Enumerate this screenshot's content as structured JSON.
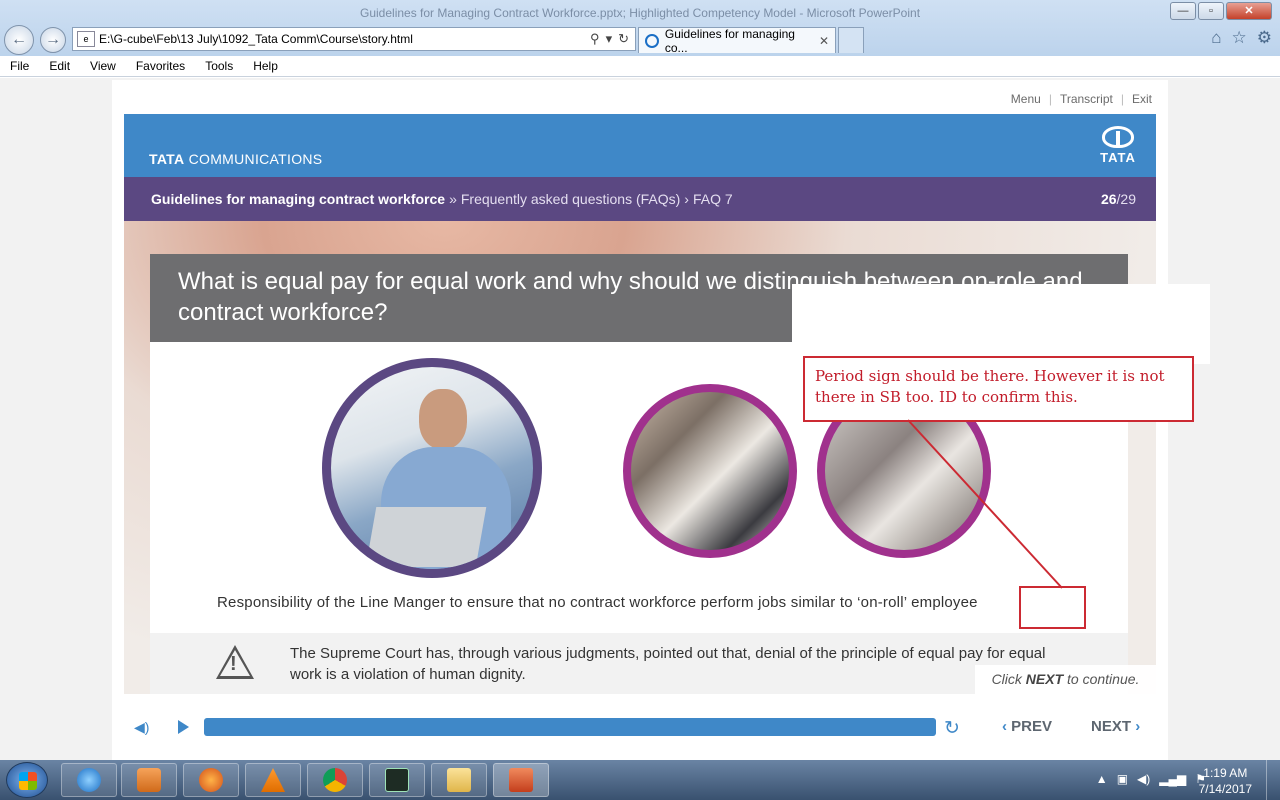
{
  "window": {
    "title": "Guidelines for Managing Contract Workforce.pptx; Highlighted Competency Model - Microsoft PowerPoint",
    "controls": {
      "minimize": "—",
      "maximize": "▫",
      "close": "✕"
    }
  },
  "browser": {
    "address": "E:\\G-cube\\Feb\\13 July\\1092_Tata Comm\\Course\\story.html",
    "tab_title": "Guidelines for managing co...",
    "menu": [
      "File",
      "Edit",
      "View",
      "Favorites",
      "Tools",
      "Help"
    ]
  },
  "player": {
    "top_links": {
      "menu": "Menu",
      "transcript": "Transcript",
      "exit": "Exit",
      "separator": "|"
    },
    "controls": {
      "prev": "PREV",
      "next": "NEXT",
      "progress_fraction": 1.0
    }
  },
  "slide": {
    "brand": {
      "bold": "TATA",
      "rest": " COMMUNICATIONS",
      "logo_word": "TATA"
    },
    "breadcrumb": {
      "course": "Guidelines for managing contract workforce",
      "sep1": "»",
      "section": "Frequently asked questions (FAQs)",
      "sep2": "›",
      "page": "FAQ 7",
      "current": "26",
      "total": "/29"
    },
    "question": "What is equal pay for equal work and why should we distinguish between on-role and contract workforce?",
    "caption": "Responsibility of the Line Manger to ensure that no contract workforce perform jobs similar to ‘on-roll’ employee",
    "notice": "The Supreme Court has, through various judgments, pointed out that, denial of the principle of equal pay for equal work is a violation of human dignity.",
    "hint": {
      "pre": "Click ",
      "bold": "NEXT",
      "post": " to continue."
    }
  },
  "annotation": {
    "text": "Period sign should be there. However it is not there in SB too. ID to confirm this.",
    "color": "#cc2a33"
  },
  "taskbar": {
    "time": "1:19 AM",
    "date": "7/14/2017"
  },
  "colors": {
    "brand_blue": "#3f88c8",
    "crumb_purple": "#5b4882",
    "circle_magenta": "#a0318d",
    "question_gray": "#6e6e70"
  }
}
